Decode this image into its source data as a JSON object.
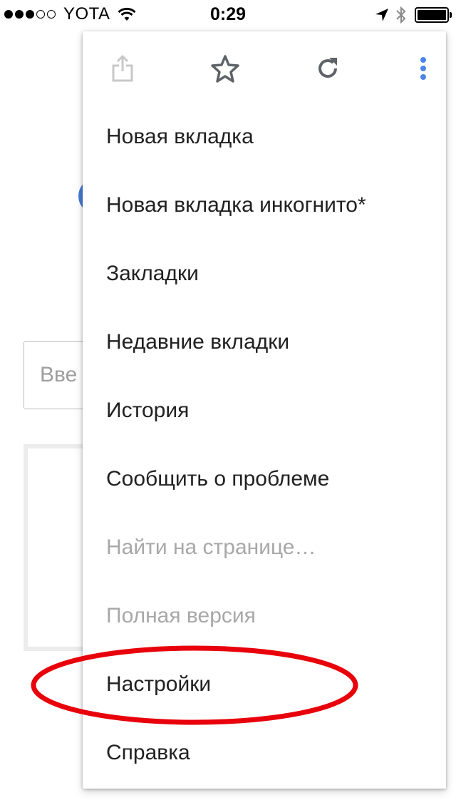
{
  "status_bar": {
    "carrier": "YOTA",
    "time": "0:29",
    "signal_bars_filled": 3,
    "signal_bars_total": 5
  },
  "background_page": {
    "search_placeholder": "Вве"
  },
  "menu": {
    "toolbar": {
      "share_icon": "share-icon",
      "bookmark_icon": "star-icon",
      "reload_icon": "reload-icon",
      "more_icon": "more-vertical-icon",
      "more_icon_color": "#4a86e8"
    },
    "items": [
      {
        "label": "Новая вкладка",
        "enabled": true
      },
      {
        "label": "Новая вкладка инкогнито*",
        "enabled": true
      },
      {
        "label": "Закладки",
        "enabled": true
      },
      {
        "label": "Недавние вкладки",
        "enabled": true
      },
      {
        "label": "История",
        "enabled": true
      },
      {
        "label": "Сообщить о проблеме",
        "enabled": true
      },
      {
        "label": "Найти на странице…",
        "enabled": false
      },
      {
        "label": "Полная версия",
        "enabled": false
      },
      {
        "label": "Настройки",
        "enabled": true,
        "highlighted": true
      },
      {
        "label": "Справка",
        "enabled": true
      }
    ]
  },
  "highlight_color": "#e8000b"
}
